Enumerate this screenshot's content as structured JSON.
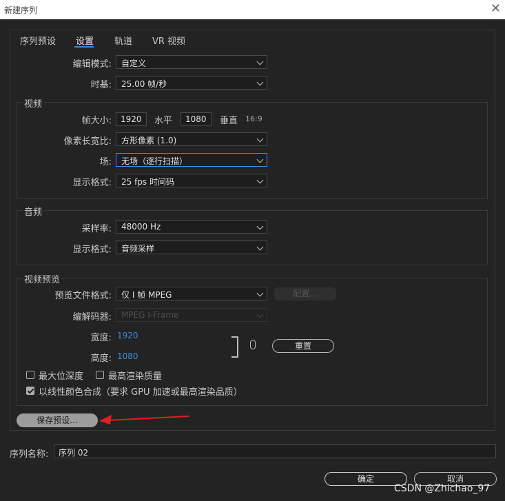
{
  "window": {
    "title": "新建序列",
    "close_symbol": "✕"
  },
  "tabs": [
    {
      "label": "序列预设",
      "active": false
    },
    {
      "label": "设置",
      "active": true
    },
    {
      "label": "轨道",
      "active": false
    },
    {
      "label": "VR 视频",
      "active": false
    }
  ],
  "settings": {
    "edit_mode_label": "编辑模式:",
    "edit_mode_value": "自定义",
    "timebase_label": "时基:",
    "timebase_value": "25.00  帧/秒"
  },
  "video": {
    "title": "视频",
    "frame_size_label": "帧大小:",
    "width_value": "1920",
    "h_label": "水平",
    "height_value": "1080",
    "v_label": "垂直",
    "aspect": "16:9",
    "pixel_aspect_label": "像素长宽比:",
    "pixel_aspect_value": "方形像素 (1.0)",
    "field_label": "场:",
    "field_value": "无场（逐行扫描）",
    "display_format_label": "显示格式:",
    "display_format_value": "25 fps 时间码"
  },
  "audio": {
    "title": "音频",
    "sample_rate_label": "采样率:",
    "sample_rate_value": "48000 Hz",
    "display_format_label": "显示格式:",
    "display_format_value": "音频采样"
  },
  "preview": {
    "title": "视频预览",
    "file_format_label": "预览文件格式:",
    "file_format_value": "仅 I 帧 MPEG",
    "config_button": "配置...",
    "codec_label": "编解码器:",
    "codec_value": "MPEG I-Frame",
    "width_label": "宽度:",
    "width_value": "1920",
    "height_label": "高度:",
    "height_value": "1080",
    "reset_button": "重置"
  },
  "options": {
    "max_depth_label": "最大位深度",
    "max_depth_checked": false,
    "max_quality_label": "最高渲染质量",
    "max_quality_checked": false,
    "linear_label": "以线性颜色合成（要求 GPU 加速或最高渲染品质）",
    "linear_checked": true
  },
  "save_preset_button": "保存预设...",
  "sequence_name_label": "序列名称:",
  "sequence_name_value": "序列 02",
  "ok_button": "确定",
  "cancel_button": "取消",
  "watermark": "CSDN @Zhichao_97",
  "colors": {
    "accent": "#2d8ceb",
    "background": "#232323",
    "annotation_arrow": "#e02020"
  }
}
